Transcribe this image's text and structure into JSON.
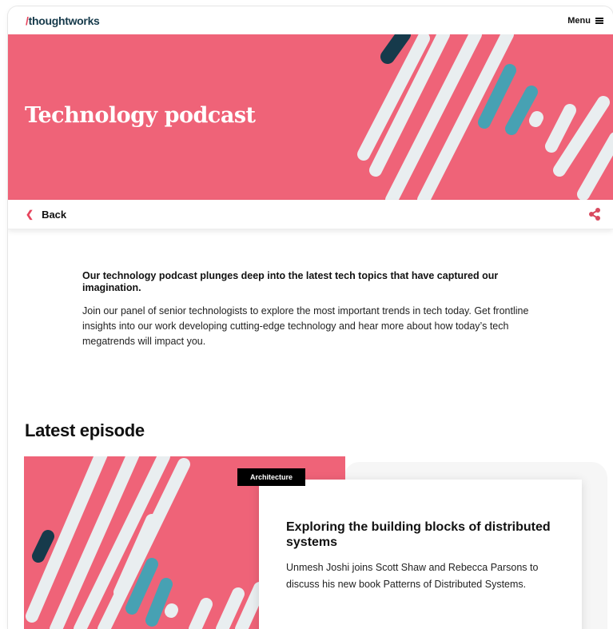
{
  "nav": {
    "logo_slash": "/",
    "logo_text": "thoughtworks",
    "menu_label": "Menu"
  },
  "hero": {
    "title": "Technology podcast",
    "bg_color": "#ef6378"
  },
  "backbar": {
    "back_label": "Back",
    "share_icon": "share-icon"
  },
  "intro": {
    "lead": "Our technology podcast plunges deep into the latest tech topics that have captured our imagination.",
    "body": "Join our panel of senior technologists to explore the most important trends in tech today. Get frontline insights into our work developing cutting-edge technology and hear more about how today’s tech megatrends will impact you."
  },
  "latest": {
    "heading": "Latest episode",
    "episode": {
      "tag": "Architecture",
      "title": "Exploring the building blocks of distributed systems",
      "description": "Unmesh Joshi joins Scott Shaw and Rebecca Parsons to discuss his new book Patterns of Distributed Systems."
    }
  },
  "colors": {
    "accent_pink": "#ef6378",
    "stripe_white": "#e9eef0",
    "stripe_teal": "#47a1b3",
    "stripe_navy": "#163a4b"
  }
}
